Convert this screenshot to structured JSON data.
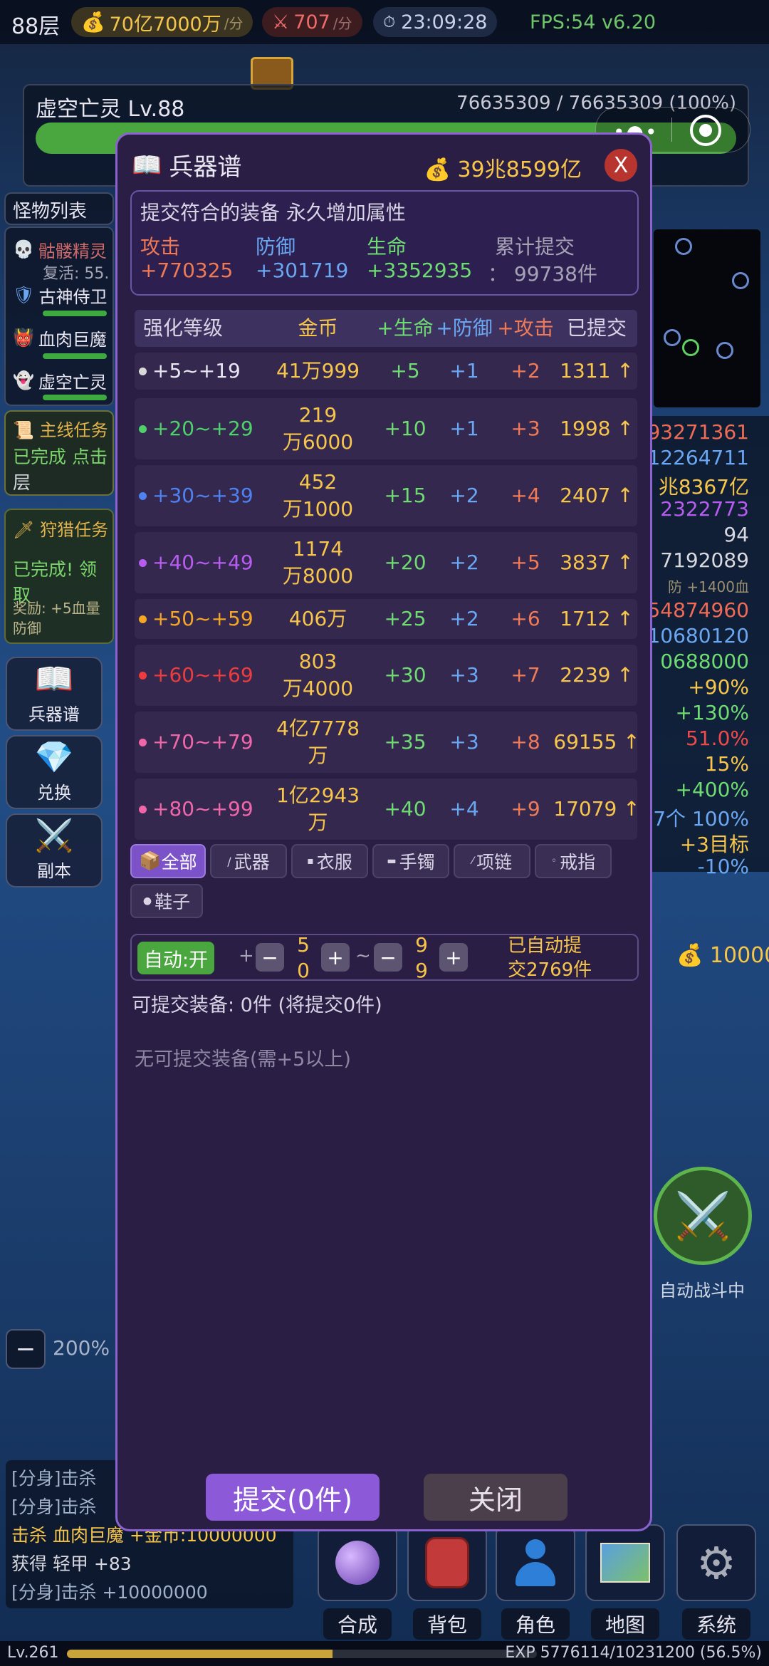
{
  "topbar": {
    "floor": "88层",
    "gold_rate": "70亿7000万",
    "gold_unit": "/分",
    "kill_rate": "707",
    "kill_unit": "/分",
    "clock": "23:09:28",
    "fps": "FPS:54 v6.20"
  },
  "boss": {
    "name": "虚空亡灵 Lv.88",
    "hp": "76635309 / 76635309 (100%)",
    "hp_fraction": 1.0
  },
  "left": {
    "monster_list_title": "怪物列表",
    "monsters": [
      {
        "name": "骷髅精灵",
        "sub": "复活: 55."
      },
      {
        "name": "古神侍卫"
      },
      {
        "name": "血肉巨魔"
      },
      {
        "name": "虚空亡灵"
      }
    ],
    "main_quest": {
      "title": "主线任务",
      "text": "已完成 点击",
      "text2": "层"
    },
    "hunt_quest": {
      "title": "狩猎任务",
      "text": "已完成! 领取",
      "reward": "奖励: +5血量",
      "reward2": "防御"
    },
    "buttons": [
      "兵器谱",
      "兑换",
      "副本"
    ]
  },
  "right": {
    "values": [
      "93271361",
      "12264711",
      "兆8367亿",
      "2322773",
      "94",
      "7192089",
      "防 +1400血",
      "54874960",
      "10680120",
      "0688000",
      "+90%",
      "+130%",
      "51.0%",
      "15%",
      "+400%",
      "7个 100%",
      "+3目标",
      "-10%"
    ],
    "gold": "10000",
    "auto_battle": "自动战斗中"
  },
  "zoom": {
    "minus": "−",
    "value": "200%"
  },
  "log": [
    "[分身]击杀",
    "[分身]击杀",
    "击杀 血肉巨魔 +金币:10000000",
    "获得 轻甲 +83",
    "[分身]击杀 +10000000"
  ],
  "dialog": {
    "title": "兵器谱",
    "gold": "39兆8599亿",
    "close_x": "X",
    "info": {
      "heading": "提交符合的装备 永久增加属性",
      "attack_label": "攻击",
      "attack_value": "+770325",
      "defense_label": "防御",
      "defense_value": "+301719",
      "life_label": "生命",
      "life_value": "+3352935",
      "total_label": "累计提交",
      "total_value": "： 99738件"
    },
    "table": {
      "headers": [
        "强化等级",
        "金币",
        "+生命",
        "+防御",
        "+攻击",
        "已提交"
      ],
      "rows": [
        {
          "level": "+5~+19",
          "dot": "#d9d9d9",
          "gold": "41万999",
          "life": "+5",
          "def": "+1",
          "atk": "+2",
          "submitted": "1311 ↑"
        },
        {
          "level": "+20~+29",
          "dot": "#4fd06a",
          "gold": "219\n万6000",
          "life": "+10",
          "def": "+1",
          "atk": "+3",
          "submitted": "1998 ↑"
        },
        {
          "level": "+30~+39",
          "dot": "#4f82f0",
          "gold": "452\n万1000",
          "life": "+15",
          "def": "+2",
          "atk": "+4",
          "submitted": "2407 ↑"
        },
        {
          "level": "+40~+49",
          "dot": "#b85cf0",
          "gold": "1174\n万8000",
          "life": "+20",
          "def": "+2",
          "atk": "+5",
          "submitted": "3837 ↑"
        },
        {
          "level": "+50~+59",
          "dot": "#f5a623",
          "gold": "406万",
          "life": "+25",
          "def": "+2",
          "atk": "+6",
          "submitted": "1712 ↑"
        },
        {
          "level": "+60~+69",
          "dot": "#ee3b3b",
          "gold": "803\n万4000",
          "life": "+30",
          "def": "+3",
          "atk": "+7",
          "submitted": "2239 ↑"
        },
        {
          "level": "+70~+79",
          "dot": "#f066a8",
          "gold": "4亿7778\n万",
          "life": "+35",
          "def": "+3",
          "atk": "+8",
          "submitted": "69155 ↑"
        },
        {
          "level": "+80~+99",
          "dot": "#f066a8",
          "gold": "1亿2943\n万",
          "life": "+40",
          "def": "+4",
          "atk": "+9",
          "submitted": "17079 ↑"
        }
      ]
    },
    "filters": [
      "全部",
      "武器",
      "衣服",
      "手镯",
      "项链",
      "戒指",
      "鞋子"
    ],
    "auto": {
      "toggle": "自动:开",
      "plus": "+",
      "minus": "−",
      "min": "5\n0",
      "tilde": "~",
      "max": "9\n9",
      "status": "已自动提\n交2769件"
    },
    "available": "可提交装备: 0件 (将提交0件)",
    "empty": "无可提交装备(需+5以上)",
    "submit": "提交(0件)",
    "close": "关闭"
  },
  "nav": [
    "合成",
    "背包",
    "角色",
    "地图",
    "系统"
  ],
  "footer": {
    "level": "Lv.261",
    "exp": "EXP 5776114/10231200 (56.5%)",
    "exp_fraction": 0.565
  }
}
